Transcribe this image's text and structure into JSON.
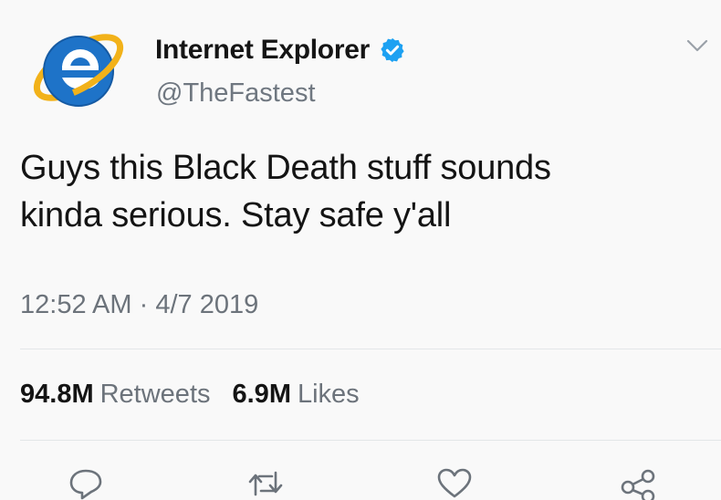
{
  "tweet": {
    "display_name": "Internet Explorer",
    "handle": "@TheFastest",
    "verified": true,
    "text_line1": "Guys this Black Death stuff sounds",
    "text_line2": "kinda serious. Stay safe y'all",
    "time": "12:52 AM",
    "separator": "·",
    "date": "4/7 2019",
    "retweets_count": "94.8M",
    "retweets_label": "Retweets",
    "likes_count": "6.9M",
    "likes_label": "Likes"
  },
  "icons": {
    "avatar": "internet-explorer-logo",
    "verified": "verified-badge-icon",
    "menu": "chevron-down-icon",
    "reply": "reply-icon",
    "retweet": "retweet-icon",
    "like": "heart-icon",
    "share": "share-icon"
  },
  "colors": {
    "verified_blue": "#1da1f2",
    "ie_blue": "#1e73c8",
    "ie_ring_gold": "#f2b21a",
    "secondary_text": "#6c737b"
  }
}
